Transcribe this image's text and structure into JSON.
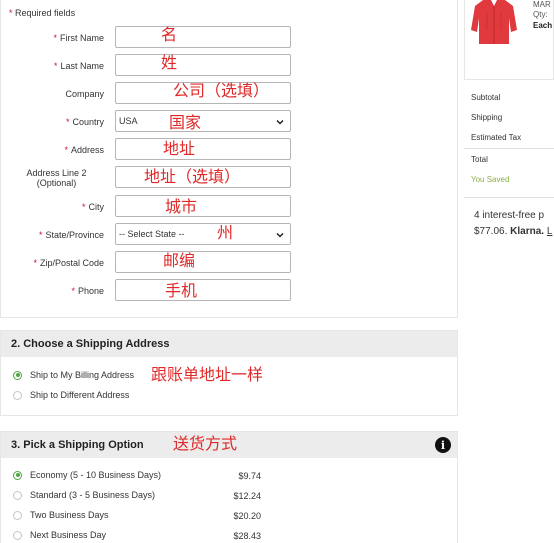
{
  "billing": {
    "required_note": "Required fields",
    "fields": [
      {
        "label": "First Name",
        "required": true,
        "value": "",
        "note": "名"
      },
      {
        "label": "Last Name",
        "required": true,
        "value": "",
        "note": "姓"
      },
      {
        "label": "Company",
        "required": false,
        "value": "",
        "note": "公司（选填）"
      },
      {
        "label": "Country",
        "required": true,
        "value": "USA",
        "note": "国家"
      },
      {
        "label": "Address",
        "required": true,
        "value": "",
        "note": "地址"
      },
      {
        "label": "Address Line 2\n(Optional)",
        "required": false,
        "value": "",
        "note": "地址（选填）"
      },
      {
        "label": "City",
        "required": true,
        "value": "",
        "note": "城市"
      },
      {
        "label": "State/Province",
        "required": true,
        "value": "-- Select State --",
        "note": "州"
      },
      {
        "label": "Zip/Postal Code",
        "required": true,
        "value": "",
        "note": "邮编"
      },
      {
        "label": "Phone",
        "required": true,
        "value": "",
        "note": "手机"
      }
    ]
  },
  "shipping_address": {
    "title": "2. Choose a Shipping Address",
    "options": [
      {
        "label": "Ship to My Billing Address",
        "checked": true
      },
      {
        "label": "Ship to Different Address",
        "checked": false
      }
    ],
    "note": "跟账单地址一样"
  },
  "shipping_option": {
    "title": "3. Pick a Shipping Option",
    "note": "送货方式",
    "info_icon": "i",
    "options": [
      {
        "label": "Economy (5 - 10 Business Days)",
        "price": "$9.74",
        "checked": true
      },
      {
        "label": "Standard (3 - 5 Business Days)",
        "price": "$12.24",
        "checked": false
      },
      {
        "label": "Two Business Days",
        "price": "$20.20",
        "checked": false
      },
      {
        "label": "Next Business Day",
        "price": "$28.43",
        "checked": false
      }
    ]
  },
  "order_summary": {
    "product_lines": [
      "MAR",
      "Qty:",
      "Each"
    ],
    "rows": [
      "Subtotal",
      "Shipping",
      "Estimated Tax"
    ],
    "total_label": "Total",
    "saved_label": "You Saved",
    "klarna_line1": "4 interest-free p",
    "klarna_amount": "$77.06.",
    "klarna_brand": "Klarna.",
    "klarna_link": "L"
  },
  "colors": {
    "accent_green": "#52a447",
    "required_red": "#c8102e",
    "note_red": "#e02828",
    "saved_green": "#8bb04b",
    "jacket_red": "#e03a3e"
  }
}
